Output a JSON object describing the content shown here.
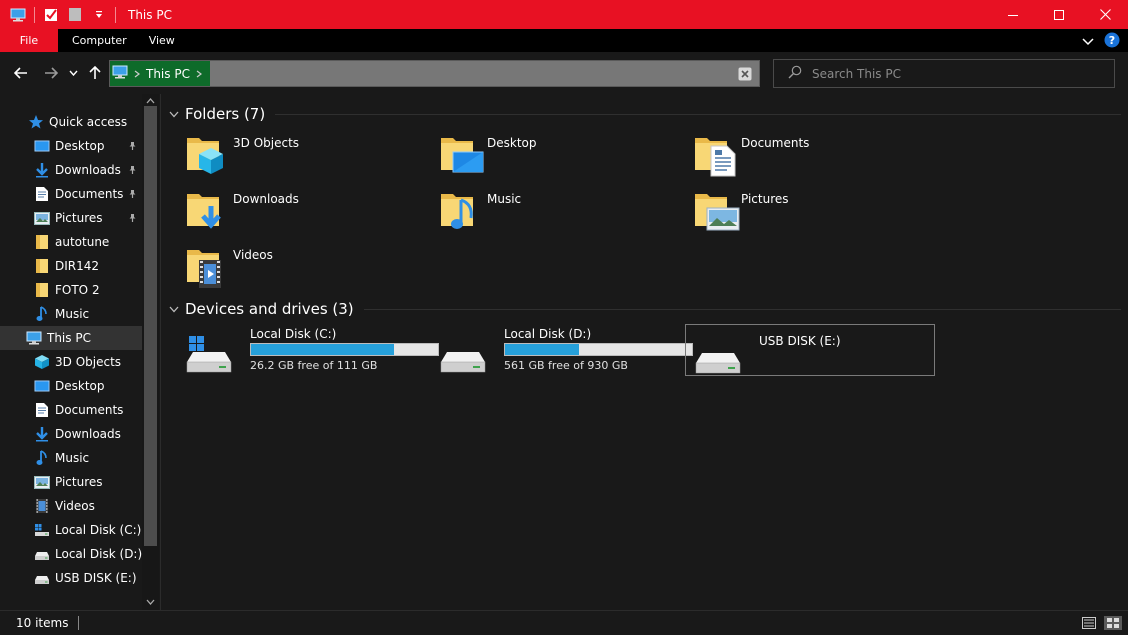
{
  "window": {
    "title": "This PC",
    "accent": "#e81123"
  },
  "ribbon": {
    "tabs": [
      "File",
      "Computer",
      "View"
    ]
  },
  "nav": {
    "address_location": "This PC",
    "search_placeholder": "Search This PC"
  },
  "sidebar": {
    "quick_access_label": "Quick access",
    "quick_items": [
      {
        "label": "Desktop",
        "icon": "desktop-icon",
        "pinned": true
      },
      {
        "label": "Downloads",
        "icon": "downloads-icon",
        "pinned": true
      },
      {
        "label": "Documents",
        "icon": "documents-icon",
        "pinned": true
      },
      {
        "label": "Pictures",
        "icon": "pictures-icon",
        "pinned": true
      },
      {
        "label": "autotune",
        "icon": "folder-icon",
        "pinned": false
      },
      {
        "label": "DIR142",
        "icon": "folder-icon",
        "pinned": false
      },
      {
        "label": "FOTO 2",
        "icon": "folder-icon",
        "pinned": false
      },
      {
        "label": "Music",
        "icon": "music-icon",
        "pinned": false
      }
    ],
    "this_pc_label": "This PC",
    "pc_items": [
      {
        "label": "3D Objects",
        "icon": "3d-objects-icon"
      },
      {
        "label": "Desktop",
        "icon": "desktop-icon"
      },
      {
        "label": "Documents",
        "icon": "documents-icon"
      },
      {
        "label": "Downloads",
        "icon": "downloads-icon"
      },
      {
        "label": "Music",
        "icon": "music-icon"
      },
      {
        "label": "Pictures",
        "icon": "pictures-icon"
      },
      {
        "label": "Videos",
        "icon": "videos-icon"
      },
      {
        "label": "Local Disk (C:)",
        "icon": "system-drive-icon"
      },
      {
        "label": "Local Disk (D:)",
        "icon": "drive-icon"
      },
      {
        "label": "USB DISK (E:)",
        "icon": "usb-drive-icon"
      }
    ]
  },
  "content": {
    "folders_header": "Folders (7)",
    "folders": [
      {
        "label": "3D Objects",
        "icon": "3d-objects-icon"
      },
      {
        "label": "Desktop",
        "icon": "desktop-icon"
      },
      {
        "label": "Documents",
        "icon": "documents-icon"
      },
      {
        "label": "Downloads",
        "icon": "downloads-icon"
      },
      {
        "label": "Music",
        "icon": "music-icon"
      },
      {
        "label": "Pictures",
        "icon": "pictures-icon"
      },
      {
        "label": "Videos",
        "icon": "videos-icon"
      }
    ],
    "drives_header": "Devices and drives (3)",
    "drives": [
      {
        "name": "Local Disk (C:)",
        "free_text": "26.2 GB free of 111 GB",
        "used_fraction": 0.764,
        "icon": "system-drive-icon",
        "show_bar": true
      },
      {
        "name": "Local Disk (D:)",
        "free_text": "561 GB free of 930 GB",
        "used_fraction": 0.397,
        "icon": "drive-icon",
        "show_bar": true
      },
      {
        "name": "USB DISK (E:)",
        "free_text": "",
        "used_fraction": null,
        "icon": "usb-drive-icon",
        "show_bar": false
      }
    ]
  },
  "status": {
    "item_count": "10 items"
  }
}
